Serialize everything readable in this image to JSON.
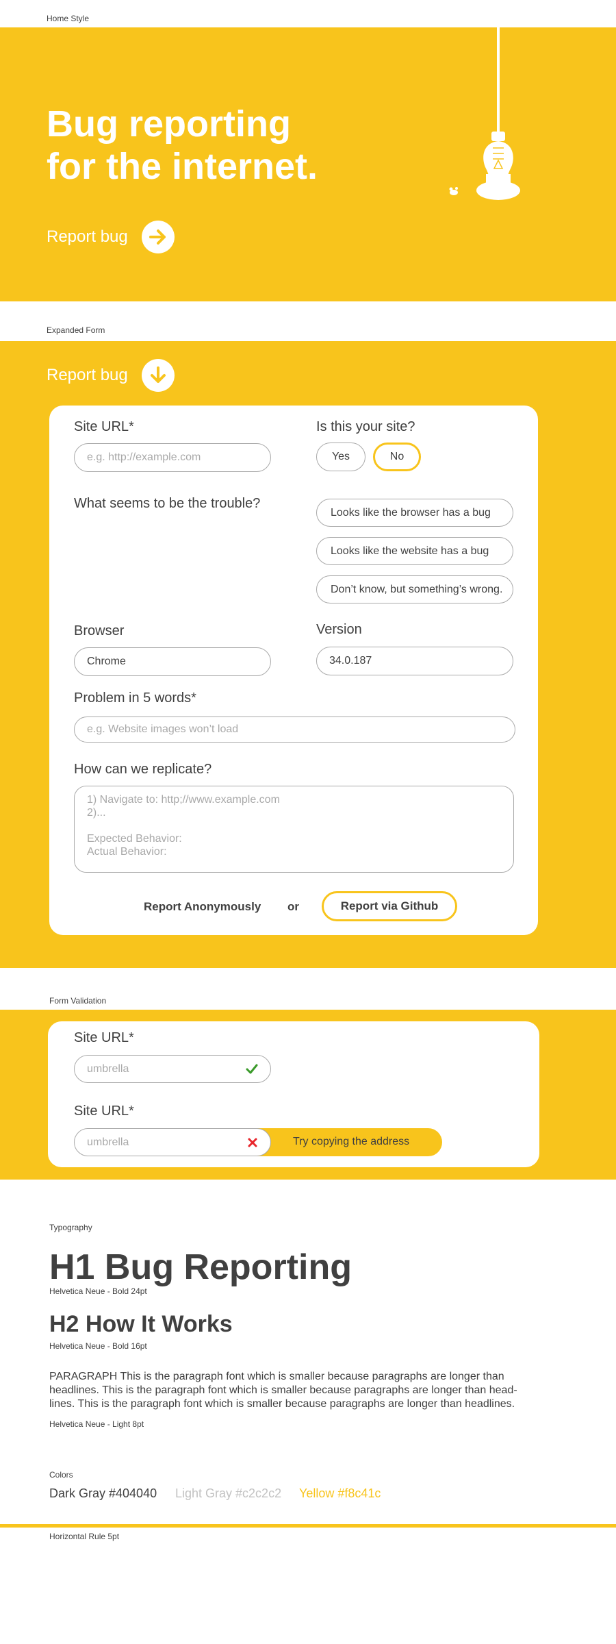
{
  "colors": {
    "yellow": "#f8c41c",
    "dark_gray": "#404040",
    "light_gray": "#c2c2c2",
    "white": "#ffffff",
    "green_check": "#3a9a2a",
    "red_x": "#e8262c"
  },
  "sections": {
    "home_style": "Home Style",
    "expanded_form": "Expanded Form",
    "form_validation": "Form Validation",
    "typography": "Typography",
    "colors": "Colors",
    "horizontal_rule": "Horizontal Rule 5pt"
  },
  "hero": {
    "title_line1": "Bug reporting",
    "title_line2": "for the internet.",
    "cta_label": "Report bug",
    "cta_icon": "arrow-right-icon",
    "illustration_icons": [
      "light-bulb-icon",
      "bug-icon"
    ]
  },
  "form": {
    "header_label": "Report bug",
    "header_icon": "arrow-down-icon",
    "site_url_label": "Site URL*",
    "site_url_placeholder": "e.g. http://example.com",
    "your_site_label": "Is this your site?",
    "yes_label": "Yes",
    "no_label": "No",
    "trouble_label": "What seems to be the trouble?",
    "trouble_options": [
      "Looks like the browser has a bug",
      "Looks like the website has a bug",
      "Don’t know, but something’s wrong."
    ],
    "browser_label": "Browser",
    "browser_value": "Chrome",
    "version_label": "Version",
    "version_value": "34.0.187",
    "problem_label": "Problem in 5 words*",
    "problem_placeholder": "e.g.  Website images won’t load",
    "replicate_label": "How can we replicate?",
    "replicate_placeholder": "1) Navigate to:  http;//www.example.com\n2)...\n\nExpected Behavior:\nActual Behavior:",
    "report_anon": "Report Anonymously",
    "or_text": "or",
    "report_github": "Report via Github"
  },
  "validation": {
    "valid_label": "Site URL*",
    "valid_value": "umbrella",
    "valid_icon": "check-icon",
    "invalid_label": "Site URL*",
    "invalid_value": "umbrella",
    "invalid_icon": "x-icon",
    "hint": "Try copying the address"
  },
  "typography": {
    "h1": "H1 Bug Reporting",
    "h1_caption": "Helvetica Neue - Bold 24pt",
    "h2": "H2 How It Works",
    "h2_caption": "Helvetica Neue - Bold 16pt",
    "paragraph": "PARAGRAPH This is the paragraph font which is smaller because paragraphs are longer than headlines.  This is the paragraph font which is smaller because paragraphs are longer than head-lines.  This is the paragraph font which is smaller because paragraphs are longer than headlines.",
    "paragraph_caption": "Helvetica Neue - Light 8pt"
  },
  "palette": {
    "dark_gray": "Dark Gray #404040",
    "light_gray": "Light Gray #c2c2c2",
    "yellow": "Yellow #f8c41c"
  }
}
